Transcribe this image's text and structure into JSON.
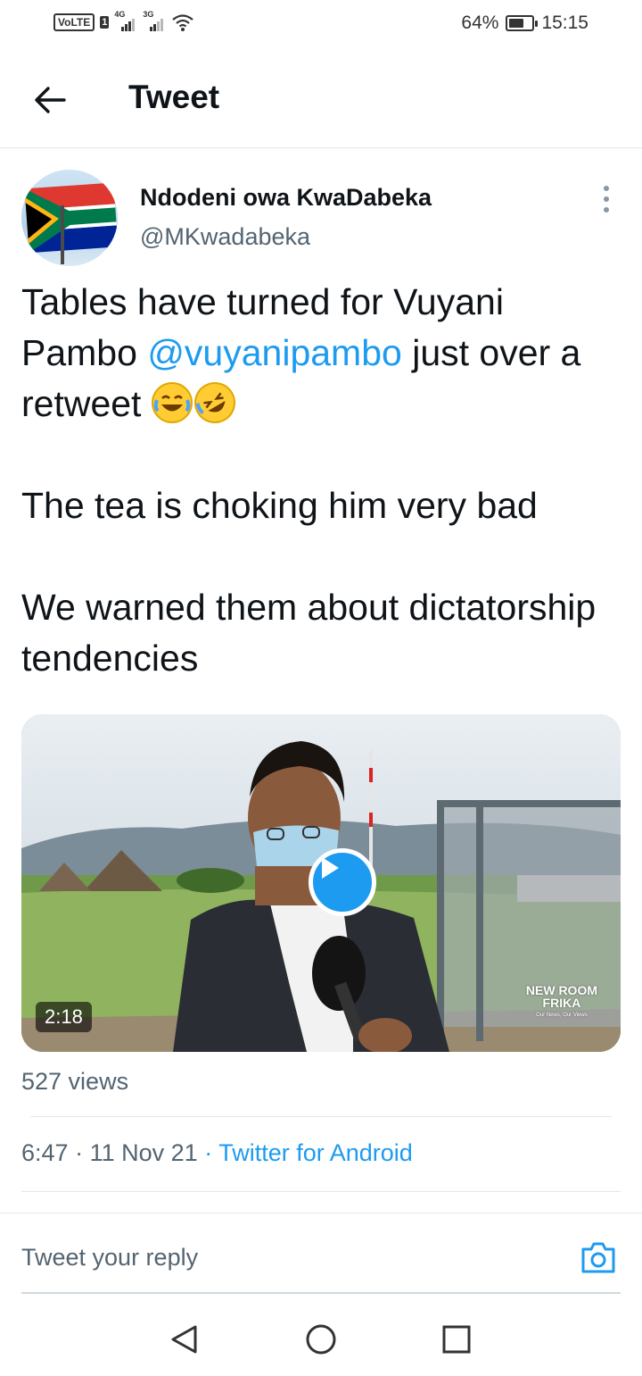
{
  "status_bar": {
    "volte": "VoLTE",
    "sim": "1",
    "net1": "4G",
    "net2": "3G",
    "battery_percent": "64%",
    "battery_level": 0.64,
    "time": "15:15"
  },
  "header": {
    "title": "Tweet",
    "back_icon": "arrow-left-icon"
  },
  "tweet": {
    "author_name": "Ndodeni owa KwaDabeka",
    "author_handle": "@MKwadabeka",
    "text_line1_a": "Tables have turned for Vuyani Pambo ",
    "mention": "@vuyanipambo",
    "text_line1_b": " just over a retweet ",
    "text_para2": "The tea is choking him very bad",
    "text_para3": "We warned them about dictatorship tendencies",
    "emojis": [
      "face-with-tears-of-joy-icon",
      "rolling-on-floor-laughing-icon"
    ],
    "video_duration": "2:18",
    "video_watermark_line1": "NEW ROOM",
    "video_watermark_line2": "FRIKA",
    "video_watermark_tagline": "Our News, Our Views",
    "views": "527 views",
    "time": "6:47",
    "sep": "·",
    "date": "11 Nov 21",
    "source": "Twitter for Android"
  },
  "reply": {
    "placeholder": "Tweet your reply",
    "camera_icon": "camera-icon"
  },
  "colors": {
    "accent": "#1d9bf0",
    "text": "#0f1419",
    "secondary": "#536471"
  }
}
